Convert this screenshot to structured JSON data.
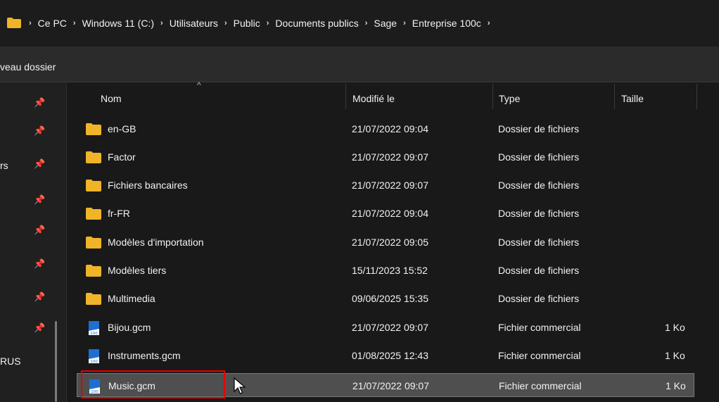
{
  "address": {
    "icon": "folder-icon",
    "crumbs": [
      "Ce PC",
      "Windows 11 (C:)",
      "Utilisateurs",
      "Public",
      "Documents publics",
      "Sage",
      "Entreprise 100c"
    ]
  },
  "toolbar": {
    "new_folder_label": "veau dossier"
  },
  "nav": {
    "label_1": "rs",
    "label_2": "RUS"
  },
  "columns": {
    "name": "Nom",
    "modified": "Modifié le",
    "type": "Type",
    "size": "Taille"
  },
  "files": [
    {
      "name": "en-GB",
      "modified": "21/07/2022 09:04",
      "type": "Dossier de fichiers",
      "size": "",
      "icon": "folder-icon"
    },
    {
      "name": "Factor",
      "modified": "21/07/2022 09:07",
      "type": "Dossier de fichiers",
      "size": "",
      "icon": "folder-icon"
    },
    {
      "name": "Fichiers bancaires",
      "modified": "21/07/2022 09:07",
      "type": "Dossier de fichiers",
      "size": "",
      "icon": "folder-icon"
    },
    {
      "name": "fr-FR",
      "modified": "21/07/2022 09:04",
      "type": "Dossier de fichiers",
      "size": "",
      "icon": "folder-icon"
    },
    {
      "name": "Modèles d'importation",
      "modified": "21/07/2022 09:05",
      "type": "Dossier de fichiers",
      "size": "",
      "icon": "folder-icon"
    },
    {
      "name": "Modèles tiers",
      "modified": "15/11/2023 15:52",
      "type": "Dossier de fichiers",
      "size": "",
      "icon": "folder-icon"
    },
    {
      "name": "Multimedia",
      "modified": "09/06/2025 15:35",
      "type": "Dossier de fichiers",
      "size": "",
      "icon": "folder-icon"
    },
    {
      "name": "Bijou.gcm",
      "modified": "21/07/2022 09:07",
      "type": "Fichier commercial",
      "size": "1 Ko",
      "icon": "gcm-file-icon"
    },
    {
      "name": "Instruments.gcm",
      "modified": "01/08/2025 12:43",
      "type": "Fichier commercial",
      "size": "1 Ko",
      "icon": "gcm-file-icon"
    },
    {
      "name": "Music.gcm",
      "modified": "21/07/2022 09:07",
      "type": "Fichier commercial",
      "size": "1 Ko",
      "icon": "gcm-file-icon",
      "selected": true
    }
  ],
  "colors": {
    "background": "#191919",
    "selection": "#4f4f4f",
    "highlight_box": "#e60000",
    "folder": "#f0b429",
    "gcm_blue": "#1e6fd1"
  }
}
